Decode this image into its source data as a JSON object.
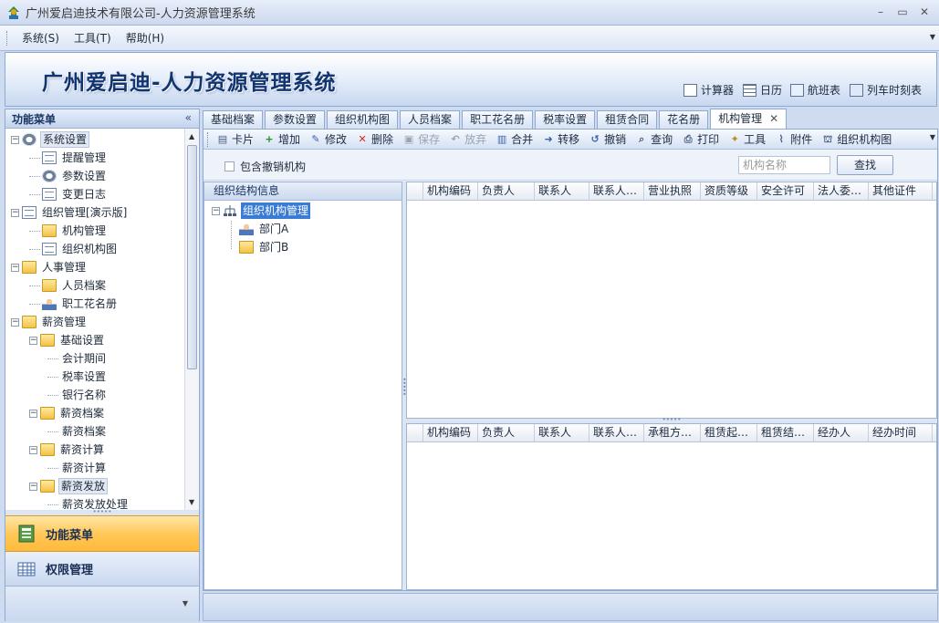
{
  "window": {
    "title": "广州爱启迪技术有限公司-人力资源管理系统",
    "controls": [
      "–",
      "▭",
      "✕"
    ]
  },
  "menu": {
    "items": [
      "系统(S)",
      "工具(T)",
      "帮助(H)"
    ]
  },
  "banner": {
    "app_title": "广州爱启迪-人力资源管理系统",
    "tools": [
      "计算器",
      "日历",
      "航班表",
      "列车时刻表"
    ]
  },
  "left_panel": {
    "title": "功能菜单",
    "collapse": "«",
    "tree": [
      {
        "label": "系统设置",
        "level": 0,
        "exp": "-",
        "icon": "gear",
        "sel": true
      },
      {
        "label": "提醒管理",
        "level": 1,
        "icon": "doc"
      },
      {
        "label": "参数设置",
        "level": 1,
        "icon": "gear"
      },
      {
        "label": "变更日志",
        "level": 1,
        "icon": "doc"
      },
      {
        "label": "组织管理[演示版]",
        "level": 0,
        "exp": "-",
        "icon": "doc"
      },
      {
        "label": "机构管理",
        "level": 1,
        "icon": "folder"
      },
      {
        "label": "组织机构图",
        "level": 1,
        "icon": "doc"
      },
      {
        "label": "人事管理",
        "level": 0,
        "exp": "-",
        "icon": "folder"
      },
      {
        "label": "人员档案",
        "level": 1,
        "icon": "folder"
      },
      {
        "label": "职工花名册",
        "level": 1,
        "icon": "user"
      },
      {
        "label": "薪资管理",
        "level": 0,
        "exp": "-",
        "icon": "folder"
      },
      {
        "label": "基础设置",
        "level": 1,
        "exp": "-",
        "icon": "folder"
      },
      {
        "label": "会计期间",
        "level": 2,
        "icon": "grid"
      },
      {
        "label": "税率设置",
        "level": 2,
        "icon": "grid"
      },
      {
        "label": "银行名称",
        "level": 2,
        "icon": "grid"
      },
      {
        "label": "薪资档案",
        "level": 1,
        "exp": "-",
        "icon": "folder"
      },
      {
        "label": "薪资档案",
        "level": 2,
        "icon": "grid"
      },
      {
        "label": "薪资计算",
        "level": 1,
        "exp": "-",
        "icon": "folder"
      },
      {
        "label": "薪资计算",
        "level": 2,
        "icon": "grid"
      },
      {
        "label": "薪资发放",
        "level": 1,
        "exp": "-",
        "icon": "folder",
        "sel": true
      },
      {
        "label": "薪资发放处理",
        "level": 2,
        "icon": "grid"
      }
    ],
    "nav": {
      "function_menu": "功能菜单",
      "permission": "权限管理"
    }
  },
  "tabs": {
    "items": [
      "基础档案",
      "参数设置",
      "组织机构图",
      "人员档案",
      "职工花名册",
      "税率设置",
      "租赁合同",
      "花名册"
    ],
    "active": "机构管理",
    "close": "✕"
  },
  "toolbar": {
    "buttons": [
      {
        "label": "卡片",
        "icon": "▤",
        "color": "#4a5f80"
      },
      {
        "label": "增加",
        "icon": "+",
        "color": "#2d8a2d"
      },
      {
        "label": "修改",
        "icon": "✎",
        "color": "#3b63a8"
      },
      {
        "label": "删除",
        "icon": "✕",
        "color": "#d22a1e"
      },
      {
        "label": "保存",
        "icon": "▣",
        "color": "#9aa3b2",
        "disabled": true
      },
      {
        "label": "放弃",
        "icon": "↶",
        "color": "#9aa3b2",
        "disabled": true
      },
      {
        "label": "合并",
        "icon": "▥",
        "color": "#3b63a8"
      },
      {
        "label": "转移",
        "icon": "➜",
        "color": "#3b63a8"
      },
      {
        "label": "撤销",
        "icon": "↺",
        "color": "#3b63a8"
      },
      {
        "label": "查询",
        "icon": "⌕",
        "color": "#4a5f80"
      },
      {
        "label": "打印",
        "icon": "⎙",
        "color": "#4a5f80"
      },
      {
        "label": "工具",
        "icon": "✦",
        "color": "#c08a20"
      },
      {
        "label": "附件",
        "icon": "⌇",
        "color": "#4a5f80"
      },
      {
        "label": "组织机构图",
        "icon": "⛫",
        "color": "#4a5f80"
      }
    ]
  },
  "filter": {
    "include_revoked": "包含撤销机构",
    "org_name_placeholder": "机构名称",
    "find": "查找"
  },
  "org_tree": {
    "title": "组织结构信息",
    "root": "组织机构管理",
    "children": [
      "部门A",
      "部门B"
    ]
  },
  "grid_top": {
    "columns": [
      "机构编码",
      "负责人",
      "联系人",
      "联系人…",
      "营业执照",
      "资质等级",
      "安全许可",
      "法人委…",
      "其他证件"
    ]
  },
  "grid_bottom": {
    "columns": [
      "机构编码",
      "负责人",
      "联系人",
      "联系人…",
      "承租方…",
      "租赁起…",
      "租赁结…",
      "经办人",
      "经办时间"
    ]
  }
}
